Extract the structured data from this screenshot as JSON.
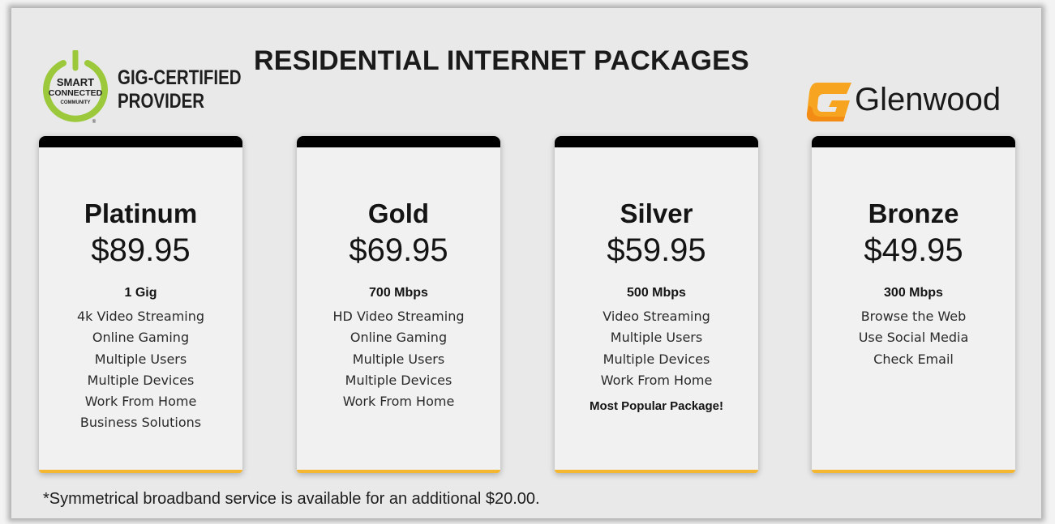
{
  "header": {
    "title": "RESIDENTIAL INTERNET PACKAGES",
    "certification": {
      "badge_line1": "SMART",
      "badge_line2": "CONNECTED",
      "badge_line3": "COMMUNITY",
      "badge_mark": "®",
      "line1": "GIG-CERTIFIED",
      "line2": "PROVIDER"
    },
    "brand": {
      "name": "Glenwood"
    }
  },
  "colors": {
    "accent": "#f5b731",
    "card_top": "#000000",
    "badge_green": "#9cc93b",
    "brand_orange": "#f7a521"
  },
  "packages": [
    {
      "name": "Platinum",
      "price": "$89.95",
      "speed": "1 Gig",
      "features": [
        "4k Video Streaming",
        "Online Gaming",
        "Multiple Users",
        "Multiple Devices",
        "Work From Home",
        "Business Solutions"
      ],
      "note": ""
    },
    {
      "name": "Gold",
      "price": "$69.95",
      "speed": "700 Mbps",
      "features": [
        "HD Video Streaming",
        "Online Gaming",
        "Multiple Users",
        "Multiple Devices",
        "Work From Home"
      ],
      "note": ""
    },
    {
      "name": "Silver",
      "price": "$59.95",
      "speed": "500 Mbps",
      "features": [
        "Video Streaming",
        "Multiple Users",
        "Multiple Devices",
        "Work From Home"
      ],
      "note": "Most Popular Package!"
    },
    {
      "name": "Bronze",
      "price": "$49.95",
      "speed": "300 Mbps",
      "features": [
        "Browse the Web",
        "Use Social Media",
        "Check Email"
      ],
      "note": ""
    }
  ],
  "footnote": "*Symmetrical broadband service is available for an additional $20.00."
}
